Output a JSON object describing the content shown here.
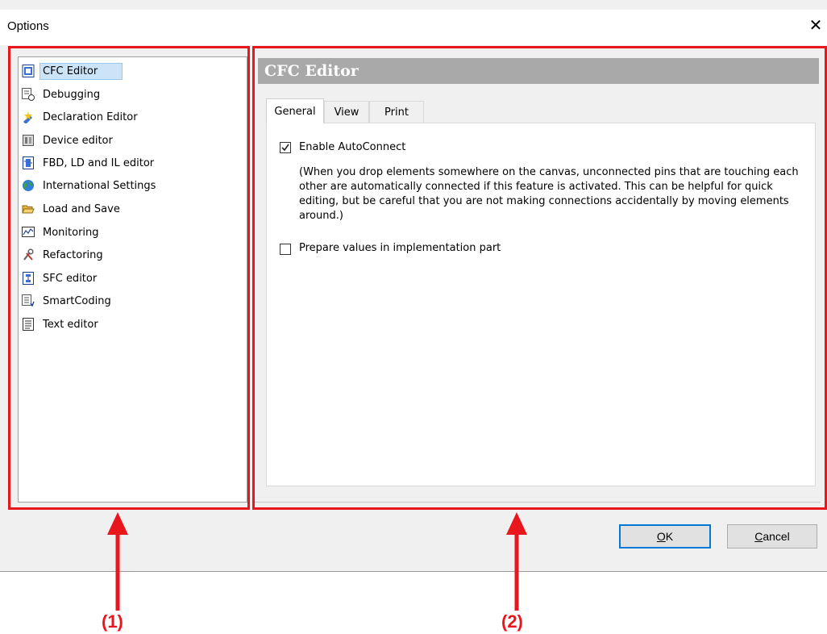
{
  "window": {
    "title": "Options",
    "close_glyph": "✕"
  },
  "tree": {
    "items": [
      {
        "label": "CFC Editor",
        "icon": "cfc-editor-icon",
        "selected": true
      },
      {
        "label": "Debugging",
        "icon": "debugging-icon",
        "selected": false
      },
      {
        "label": "Declaration Editor",
        "icon": "declaration-editor-icon",
        "selected": false
      },
      {
        "label": "Device editor",
        "icon": "device-editor-icon",
        "selected": false
      },
      {
        "label": "FBD, LD and IL editor",
        "icon": "fbd-ld-il-editor-icon",
        "selected": false
      },
      {
        "label": "International Settings",
        "icon": "globe-icon",
        "selected": false
      },
      {
        "label": "Load and Save",
        "icon": "folder-open-icon",
        "selected": false
      },
      {
        "label": "Monitoring",
        "icon": "monitoring-icon",
        "selected": false
      },
      {
        "label": "Refactoring",
        "icon": "refactoring-tools-icon",
        "selected": false
      },
      {
        "label": "SFC editor",
        "icon": "sfc-editor-icon",
        "selected": false
      },
      {
        "label": "SmartCoding",
        "icon": "smartcoding-icon",
        "selected": false
      },
      {
        "label": "Text editor",
        "icon": "text-editor-icon",
        "selected": false
      }
    ]
  },
  "panel": {
    "header": "CFC Editor",
    "tabs": [
      {
        "label": "General",
        "active": true
      },
      {
        "label": "View",
        "active": false
      },
      {
        "label": "Print",
        "active": false
      }
    ],
    "options": [
      {
        "label": "Enable AutoConnect",
        "checked": true
      },
      {
        "label": "Prepare values in implementation part",
        "checked": false
      }
    ],
    "description": "(When you drop elements somewhere on the canvas, unconnected pins that are touching each other are automatically connected if this feature is activated. This can be helpful for quick editing, but be careful that you are not making connections accidentally by moving elements around.)"
  },
  "buttons": {
    "ok": {
      "mnemonic": "O",
      "rest": "K"
    },
    "cancel": {
      "mnemonic": "C",
      "rest": "ancel"
    }
  },
  "annotations": {
    "left": "(1)",
    "right": "(2)"
  },
  "colors": {
    "annotation": "#e8161d",
    "selection": "#cce4f7",
    "header_bg": "#a9a9a9",
    "default_button_border": "#0078d7"
  }
}
